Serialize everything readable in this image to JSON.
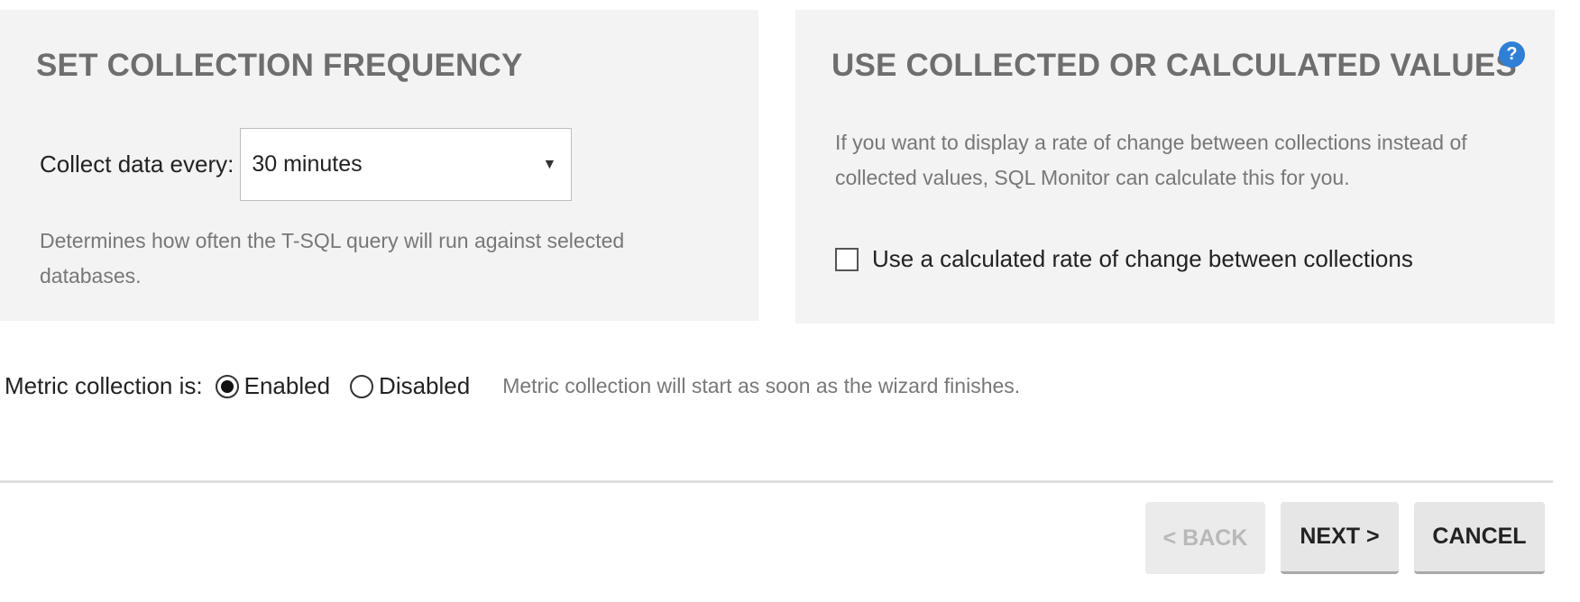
{
  "frequency_panel": {
    "title": "SET COLLECTION FREQUENCY",
    "collect_label": "Collect data every:",
    "select": {
      "value": "30 minutes",
      "caret": "▼"
    },
    "help_text": "Determines how often the T-SQL query will run against selected databases."
  },
  "values_panel": {
    "title": "USE COLLECTED OR CALCULATED VALUES",
    "help_icon": "?",
    "help_text": "If you want to display a rate of change between collections instead of collected values, SQL Monitor can calculate this for you.",
    "checkbox_label": "Use a calculated rate of change between collections",
    "checkbox_checked": false
  },
  "metric_collection": {
    "label": "Metric collection is:",
    "options": [
      {
        "label": "Enabled",
        "selected": true
      },
      {
        "label": "Disabled",
        "selected": false
      }
    ],
    "note": "Metric collection will start as soon as the wizard finishes."
  },
  "footer": {
    "back_label": "< BACK",
    "next_label": "NEXT >",
    "cancel_label": "CANCEL"
  },
  "colors": {
    "panel_bg": "#f3f3f3",
    "title_gray": "#6e6e6e",
    "help_blue": "#2f7fd6",
    "muted_text": "#777777"
  }
}
